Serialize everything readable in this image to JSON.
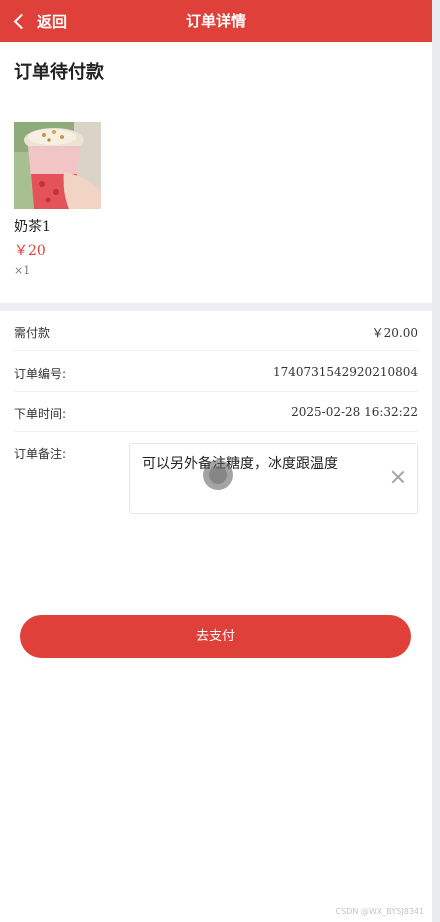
{
  "navbar": {
    "back_label": "返回",
    "title": "订单详情"
  },
  "order": {
    "status": "订单待付款",
    "product": {
      "name": "奶茶1",
      "price": "￥20",
      "quantity": "×1"
    },
    "rows": {
      "amount": {
        "label": "需付款",
        "value": "￥20.00"
      },
      "order_no": {
        "label": "订单编号:",
        "value": "1740731542920210804"
      },
      "order_time": {
        "label": "下单时间:",
        "value": "2025-02-28 16:32:22"
      },
      "note": {
        "label": "订单备注:",
        "value": "可以另外备注糖度，冰度跟温度"
      }
    }
  },
  "actions": {
    "pay_label": "去支付"
  },
  "colors": {
    "brand_red": "#e0403a"
  },
  "watermark": "CSDN @WX_BYSJ8341"
}
